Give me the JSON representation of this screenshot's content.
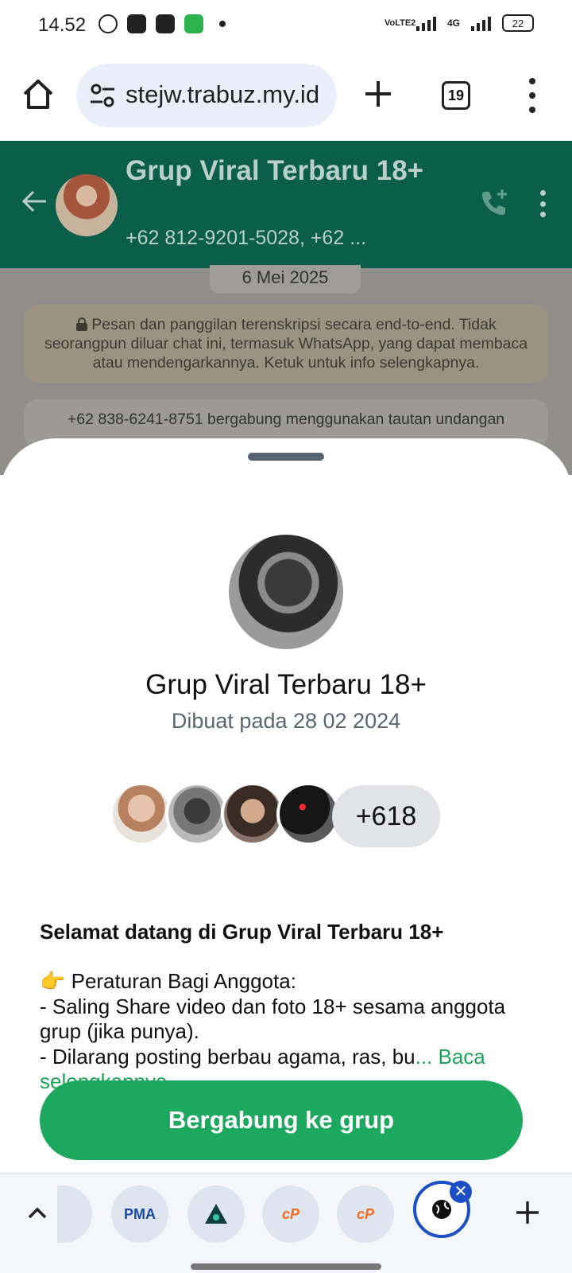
{
  "status_bar": {
    "time": "14.52",
    "volte": "VoLTE2",
    "network": "4G",
    "battery": "22"
  },
  "browser": {
    "url": "stejw.trabuz.my.id",
    "tab_count": "19",
    "icons": [
      "home-icon",
      "site-settings-icon",
      "new-tab-icon",
      "tab-switcher-icon",
      "overflow-menu-icon"
    ]
  },
  "chat_header": {
    "title": "Grup Viral Terbaru 18+",
    "subtitle": "+62 812-9201-5028, +62 ...",
    "header_color": "#0a5e4a"
  },
  "chat": {
    "date": "6 Mei 2025",
    "encryption_notice": "Pesan dan panggilan terenskripsi secara end-to-end. Tidak seorangpun diluar chat ini, termasuk WhatsApp, yang dapat membaca atau mendengarkannya. Ketuk untuk info selengkapnya.",
    "system_message": "+62 838-6241-8751 bergabung menggunakan tautan undangan"
  },
  "sheet": {
    "group_name": "Grup Viral Terbaru 18+",
    "created": "Dibuat pada 28 02 2024",
    "member_more": "+618",
    "welcome": "Selamat datang di Grup Viral Terbaru 18+",
    "rules_heading": "👉 Peraturan Bagi Anggota:",
    "rule1": "- Saling Share video dan foto 18+ sesama anggota grup (jika punya).",
    "rule2": "- Dilarang posting berbau agama, ras, bu",
    "read_more": "... Baca selengkapnya",
    "join_button": "Bergabung ke grup",
    "accent": "#1da85f"
  },
  "tab_strip": {
    "tab1_label": "PMA",
    "tab3_label": "cP",
    "tab4_label": "cP",
    "close_label": "✕"
  }
}
